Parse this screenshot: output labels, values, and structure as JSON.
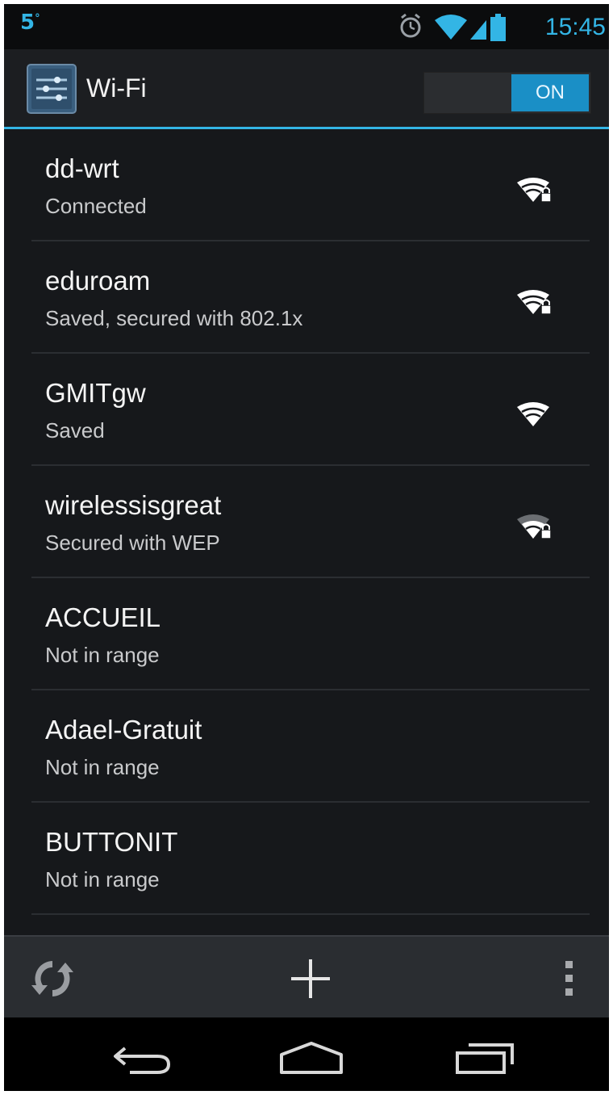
{
  "status_bar": {
    "left_label": "5",
    "left_degree": "°",
    "time": "15:45"
  },
  "action_bar": {
    "app_icon": "settings-sliders-icon",
    "title": "Wi-Fi",
    "toggle_label": "ON"
  },
  "networks": [
    {
      "name": "dd-wrt",
      "status": "Connected",
      "signal": "wifi-locked-icon",
      "level": 4,
      "secured": true
    },
    {
      "name": "eduroam",
      "status": "Saved, secured with 802.1x",
      "signal": "wifi-locked-icon",
      "level": 4,
      "secured": true
    },
    {
      "name": "GMITgw",
      "status": "Saved",
      "signal": "wifi-icon",
      "level": 4,
      "secured": false
    },
    {
      "name": "wirelessisgreat",
      "status": "Secured with WEP",
      "signal": "wifi-locked-icon",
      "level": 3,
      "secured": true
    },
    {
      "name": "ACCUEIL",
      "status": "Not in range"
    },
    {
      "name": "Adael-Gratuit",
      "status": "Not in range"
    },
    {
      "name": "BUTTONIT",
      "status": "Not in range"
    }
  ],
  "bottom_bar": {
    "scan_icon": "refresh-icon",
    "add_icon": "plus-icon",
    "overflow_icon": "overflow-menu-icon"
  },
  "nav_bar": {
    "back_icon": "back-icon",
    "home_icon": "home-icon",
    "recents_icon": "recent-apps-icon"
  },
  "colors": {
    "accent": "#33b5e5",
    "toggle_on": "#1a8fc6",
    "background": "#16181b"
  }
}
